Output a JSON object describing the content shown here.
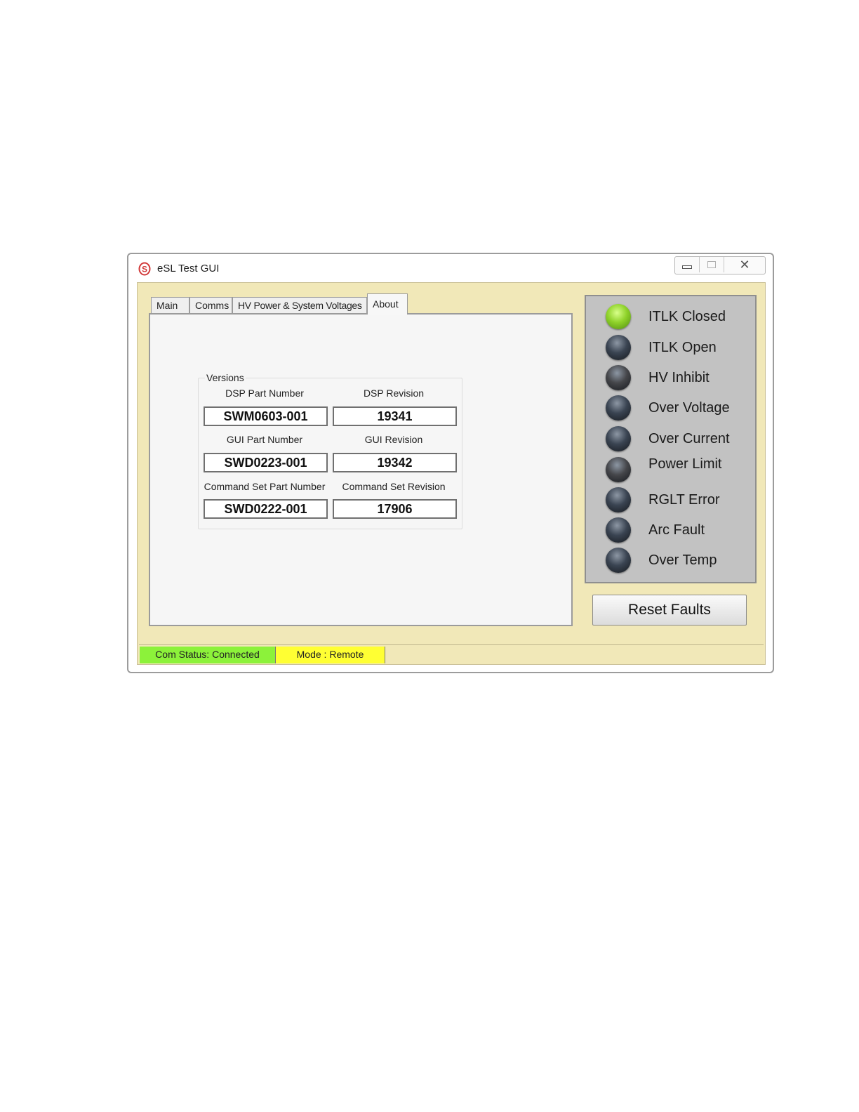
{
  "window": {
    "title": "eSL Test GUI",
    "controls": {
      "minimize": "minimize",
      "maximize": "maximize",
      "close": "close"
    }
  },
  "tabs": [
    {
      "label": "Main",
      "active": false
    },
    {
      "label": "Comms",
      "active": false
    },
    {
      "label": "HV Power & System Voltages",
      "active": false
    },
    {
      "label": "About",
      "active": true
    }
  ],
  "versions": {
    "legend": "Versions",
    "dsp_part_label": "DSP Part Number",
    "dsp_part_value": "SWM0603-001",
    "dsp_rev_label": "DSP Revision",
    "dsp_rev_value": "19341",
    "gui_part_label": "GUI Part Number",
    "gui_part_value": "SWD0223-001",
    "gui_rev_label": "GUI Revision",
    "gui_rev_value": "19342",
    "cmd_part_label": "Command Set Part Number",
    "cmd_part_value": "SWD0222-001",
    "cmd_rev_label": "Command Set Revision",
    "cmd_rev_value": "17906"
  },
  "indicators": [
    {
      "label": "ITLK Closed",
      "state": "on",
      "color": "#8fd22a"
    },
    {
      "label": "ITLK Open",
      "state": "off",
      "color": "#3a4452"
    },
    {
      "label": "HV Inhibit",
      "state": "off",
      "color": "#45464a"
    },
    {
      "label": "Over Voltage",
      "state": "off",
      "color": "#3a4452"
    },
    {
      "label": "Over Current",
      "state": "off",
      "color": "#3a4452"
    },
    {
      "label": "Power Limit",
      "state": "off",
      "color": "#45464a"
    },
    {
      "label": "RGLT Error",
      "state": "off",
      "color": "#3a4452"
    },
    {
      "label": "Arc Fault",
      "state": "off",
      "color": "#3a4452"
    },
    {
      "label": "Over Temp",
      "state": "off",
      "color": "#3a4452"
    }
  ],
  "reset_button": {
    "label": "Reset Faults"
  },
  "statusbar": {
    "com_status": "Com Status: Connected",
    "com_color": "#8cf23a",
    "mode": "Mode : Remote",
    "mode_color": "#ffff33"
  },
  "colors": {
    "client_bg": "#f1e8b8",
    "panel_bg": "#c2c2c2"
  }
}
